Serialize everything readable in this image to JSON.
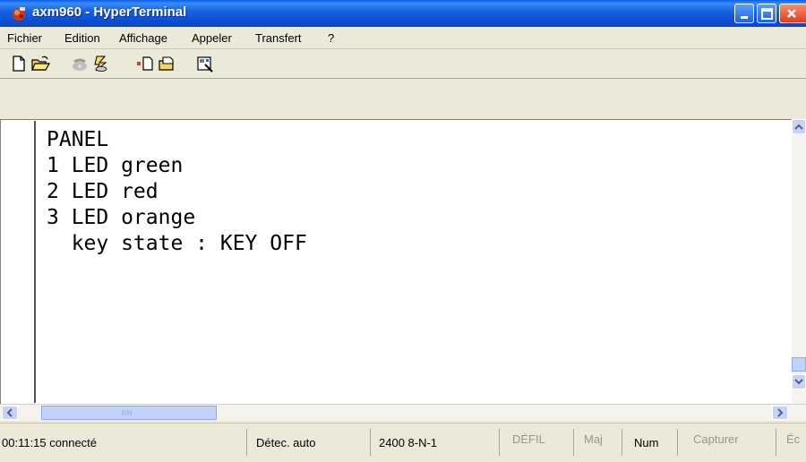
{
  "window": {
    "title": "axm960 - HyperTerminal",
    "accent_color": "#0a5ce8"
  },
  "menu": {
    "items": [
      "Fichier",
      "Edition",
      "Affichage",
      "Appeler",
      "Transfert",
      "?"
    ]
  },
  "toolbar": {
    "icons": [
      "new-document-icon",
      "open-folder-icon",
      "phone-icon",
      "disconnect-icon",
      "send-icon",
      "receive-icon",
      "properties-icon"
    ]
  },
  "terminal": {
    "lines": [
      "PANEL",
      "1 LED green",
      "2 LED red",
      "3 LED orange",
      "  key state : KEY OFF"
    ]
  },
  "status": {
    "connection": "00:11:15 connecté",
    "detect": "Détec. auto",
    "settings": "2400 8-N-1",
    "scroll": "DÉFIL",
    "caps": "Maj",
    "num": "Num",
    "capture": "Capturer",
    "echo": "Éc"
  }
}
